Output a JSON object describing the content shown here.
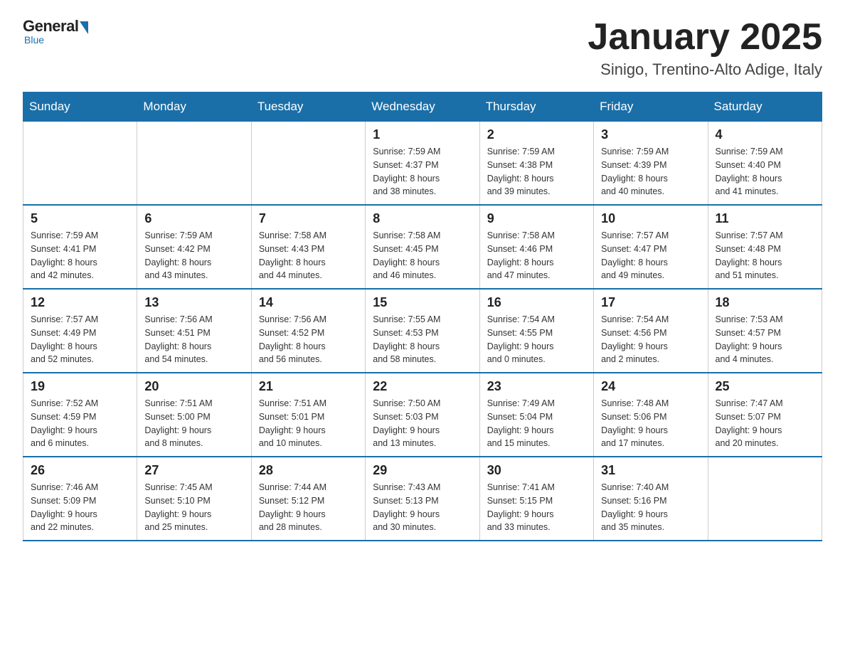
{
  "logo": {
    "general": "General",
    "blue": "Blue",
    "arrow_color": "#1a6fa8"
  },
  "title": "January 2025",
  "location": "Sinigo, Trentino-Alto Adige, Italy",
  "days_of_week": [
    "Sunday",
    "Monday",
    "Tuesday",
    "Wednesday",
    "Thursday",
    "Friday",
    "Saturday"
  ],
  "weeks": [
    [
      {
        "day": "",
        "info": ""
      },
      {
        "day": "",
        "info": ""
      },
      {
        "day": "",
        "info": ""
      },
      {
        "day": "1",
        "info": "Sunrise: 7:59 AM\nSunset: 4:37 PM\nDaylight: 8 hours\nand 38 minutes."
      },
      {
        "day": "2",
        "info": "Sunrise: 7:59 AM\nSunset: 4:38 PM\nDaylight: 8 hours\nand 39 minutes."
      },
      {
        "day": "3",
        "info": "Sunrise: 7:59 AM\nSunset: 4:39 PM\nDaylight: 8 hours\nand 40 minutes."
      },
      {
        "day": "4",
        "info": "Sunrise: 7:59 AM\nSunset: 4:40 PM\nDaylight: 8 hours\nand 41 minutes."
      }
    ],
    [
      {
        "day": "5",
        "info": "Sunrise: 7:59 AM\nSunset: 4:41 PM\nDaylight: 8 hours\nand 42 minutes."
      },
      {
        "day": "6",
        "info": "Sunrise: 7:59 AM\nSunset: 4:42 PM\nDaylight: 8 hours\nand 43 minutes."
      },
      {
        "day": "7",
        "info": "Sunrise: 7:58 AM\nSunset: 4:43 PM\nDaylight: 8 hours\nand 44 minutes."
      },
      {
        "day": "8",
        "info": "Sunrise: 7:58 AM\nSunset: 4:45 PM\nDaylight: 8 hours\nand 46 minutes."
      },
      {
        "day": "9",
        "info": "Sunrise: 7:58 AM\nSunset: 4:46 PM\nDaylight: 8 hours\nand 47 minutes."
      },
      {
        "day": "10",
        "info": "Sunrise: 7:57 AM\nSunset: 4:47 PM\nDaylight: 8 hours\nand 49 minutes."
      },
      {
        "day": "11",
        "info": "Sunrise: 7:57 AM\nSunset: 4:48 PM\nDaylight: 8 hours\nand 51 minutes."
      }
    ],
    [
      {
        "day": "12",
        "info": "Sunrise: 7:57 AM\nSunset: 4:49 PM\nDaylight: 8 hours\nand 52 minutes."
      },
      {
        "day": "13",
        "info": "Sunrise: 7:56 AM\nSunset: 4:51 PM\nDaylight: 8 hours\nand 54 minutes."
      },
      {
        "day": "14",
        "info": "Sunrise: 7:56 AM\nSunset: 4:52 PM\nDaylight: 8 hours\nand 56 minutes."
      },
      {
        "day": "15",
        "info": "Sunrise: 7:55 AM\nSunset: 4:53 PM\nDaylight: 8 hours\nand 58 minutes."
      },
      {
        "day": "16",
        "info": "Sunrise: 7:54 AM\nSunset: 4:55 PM\nDaylight: 9 hours\nand 0 minutes."
      },
      {
        "day": "17",
        "info": "Sunrise: 7:54 AM\nSunset: 4:56 PM\nDaylight: 9 hours\nand 2 minutes."
      },
      {
        "day": "18",
        "info": "Sunrise: 7:53 AM\nSunset: 4:57 PM\nDaylight: 9 hours\nand 4 minutes."
      }
    ],
    [
      {
        "day": "19",
        "info": "Sunrise: 7:52 AM\nSunset: 4:59 PM\nDaylight: 9 hours\nand 6 minutes."
      },
      {
        "day": "20",
        "info": "Sunrise: 7:51 AM\nSunset: 5:00 PM\nDaylight: 9 hours\nand 8 minutes."
      },
      {
        "day": "21",
        "info": "Sunrise: 7:51 AM\nSunset: 5:01 PM\nDaylight: 9 hours\nand 10 minutes."
      },
      {
        "day": "22",
        "info": "Sunrise: 7:50 AM\nSunset: 5:03 PM\nDaylight: 9 hours\nand 13 minutes."
      },
      {
        "day": "23",
        "info": "Sunrise: 7:49 AM\nSunset: 5:04 PM\nDaylight: 9 hours\nand 15 minutes."
      },
      {
        "day": "24",
        "info": "Sunrise: 7:48 AM\nSunset: 5:06 PM\nDaylight: 9 hours\nand 17 minutes."
      },
      {
        "day": "25",
        "info": "Sunrise: 7:47 AM\nSunset: 5:07 PM\nDaylight: 9 hours\nand 20 minutes."
      }
    ],
    [
      {
        "day": "26",
        "info": "Sunrise: 7:46 AM\nSunset: 5:09 PM\nDaylight: 9 hours\nand 22 minutes."
      },
      {
        "day": "27",
        "info": "Sunrise: 7:45 AM\nSunset: 5:10 PM\nDaylight: 9 hours\nand 25 minutes."
      },
      {
        "day": "28",
        "info": "Sunrise: 7:44 AM\nSunset: 5:12 PM\nDaylight: 9 hours\nand 28 minutes."
      },
      {
        "day": "29",
        "info": "Sunrise: 7:43 AM\nSunset: 5:13 PM\nDaylight: 9 hours\nand 30 minutes."
      },
      {
        "day": "30",
        "info": "Sunrise: 7:41 AM\nSunset: 5:15 PM\nDaylight: 9 hours\nand 33 minutes."
      },
      {
        "day": "31",
        "info": "Sunrise: 7:40 AM\nSunset: 5:16 PM\nDaylight: 9 hours\nand 35 minutes."
      },
      {
        "day": "",
        "info": ""
      }
    ]
  ]
}
